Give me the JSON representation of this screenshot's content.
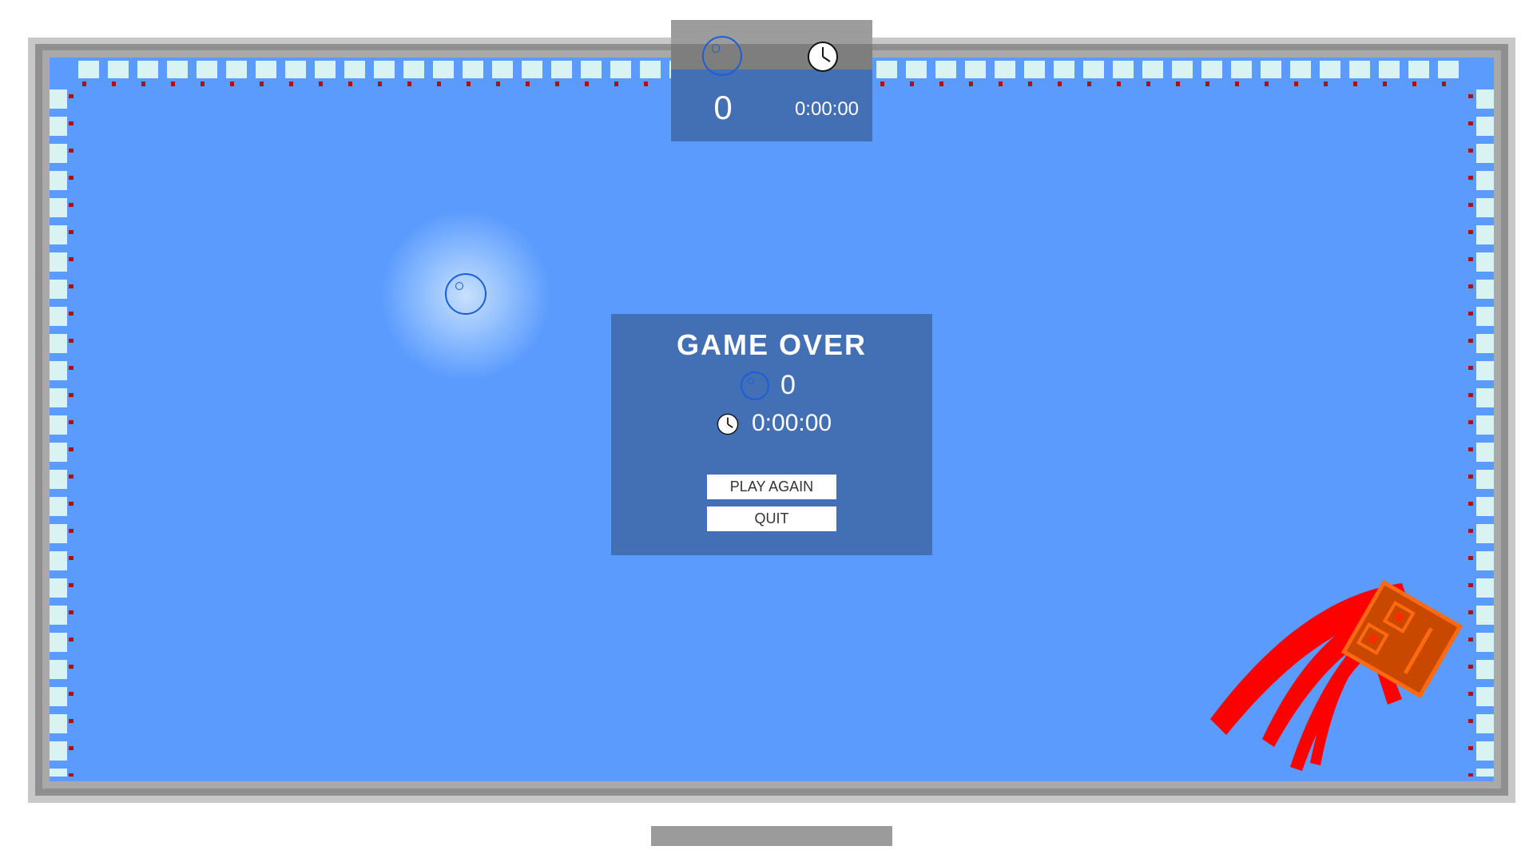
{
  "hud": {
    "bubble_icon": "bubble-icon",
    "clock_icon": "clock-icon",
    "score": "0",
    "time": "0:00:00"
  },
  "game_over": {
    "title": "GAME OVER",
    "bubble_icon": "bubble-icon",
    "score": "0",
    "clock_icon": "clock-icon",
    "time": "0:00:00",
    "play_again_label": "PLAY AGAIN",
    "quit_label": "QUIT"
  },
  "colors": {
    "water": "#5b9bfd",
    "panel": "#436fb4",
    "bubble": "#1a5fd8",
    "player_body": "#c84800",
    "player_outline": "#ff6a10",
    "player_trail": "#ff0000",
    "wall_tile": "#d9f3f3",
    "wall_accent": "#b01010"
  }
}
